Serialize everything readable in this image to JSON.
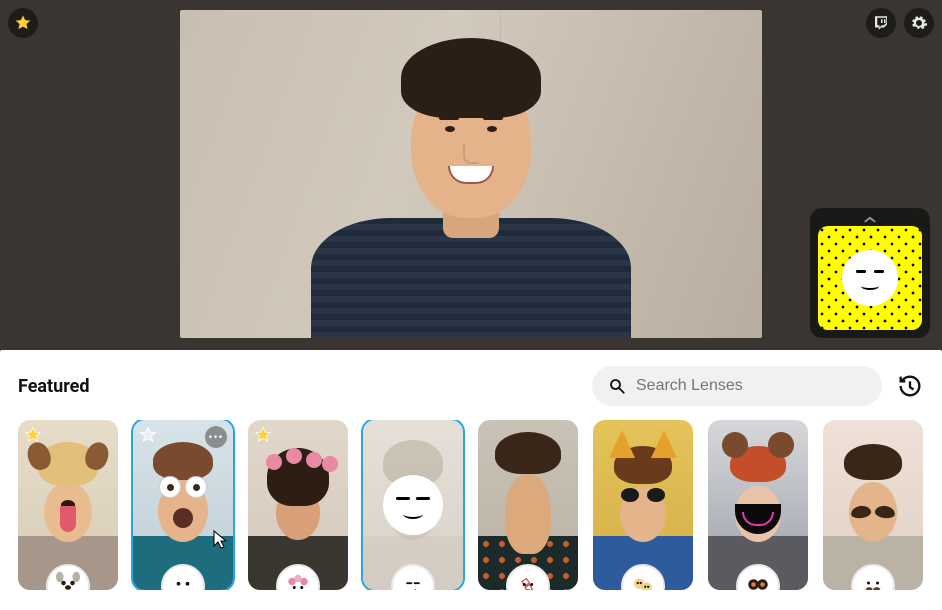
{
  "toolbar": {
    "favorites_icon": "star-icon",
    "twitch_icon": "twitch-icon",
    "settings_icon": "gear-icon"
  },
  "snapcode": {
    "expand_icon": "chevron-up-icon",
    "lens_face": "smirk"
  },
  "panel": {
    "title": "Featured",
    "history_icon": "history-icon"
  },
  "search": {
    "placeholder": "Search Lenses",
    "value": ""
  },
  "lenses": [
    {
      "name": "dog",
      "starred": true,
      "selected": false,
      "more": false
    },
    {
      "name": "big-eyes",
      "starred": true,
      "selected": true,
      "more": true
    },
    {
      "name": "flower-crown",
      "starred": true,
      "selected": false,
      "more": false
    },
    {
      "name": "smirk",
      "starred": false,
      "selected": true,
      "more": false
    },
    {
      "name": "long-chin",
      "starred": false,
      "selected": false,
      "more": false
    },
    {
      "name": "cat-ears",
      "starred": false,
      "selected": false,
      "more": false
    },
    {
      "name": "neon-mask",
      "starred": false,
      "selected": false,
      "more": false
    },
    {
      "name": "mustache",
      "starred": false,
      "selected": false,
      "more": false
    }
  ],
  "colors": {
    "brand_yellow": "#FFFC00",
    "selection_blue": "#29a6e0"
  }
}
